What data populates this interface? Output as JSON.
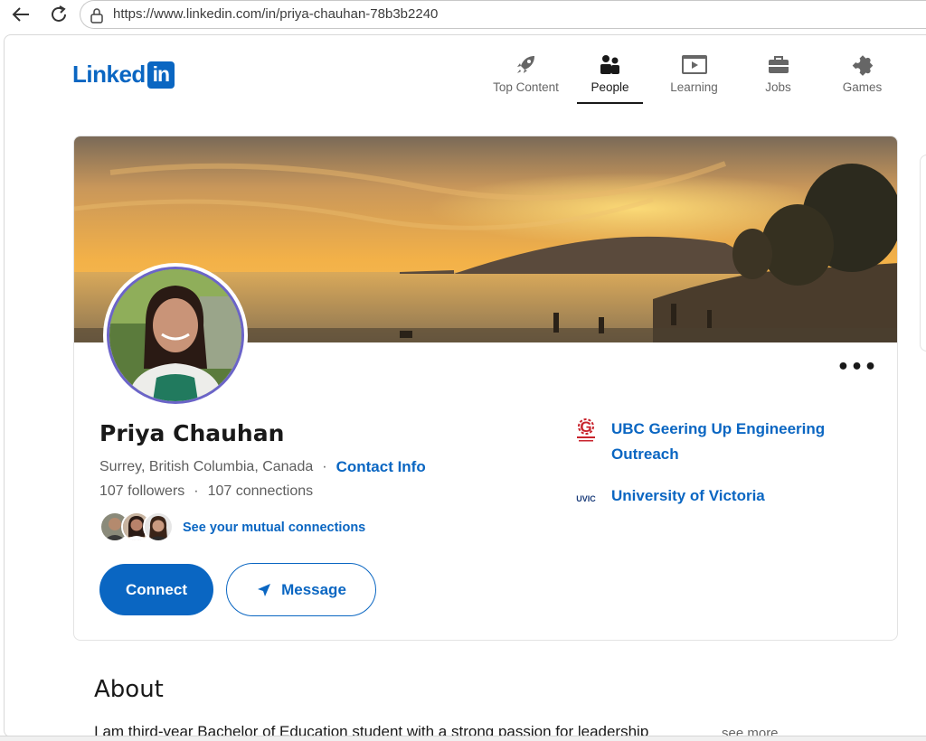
{
  "browser": {
    "url": "https://www.linkedin.com/in/priya-chauhan-78b3b2240"
  },
  "header": {
    "logo_text": "Linked",
    "logo_box": "in",
    "nav": [
      {
        "label": "Top Content",
        "icon": "rocket-icon"
      },
      {
        "label": "People",
        "icon": "people-icon"
      },
      {
        "label": "Learning",
        "icon": "video-icon"
      },
      {
        "label": "Jobs",
        "icon": "briefcase-icon"
      },
      {
        "label": "Games",
        "icon": "puzzle-icon"
      }
    ],
    "active_nav": "People"
  },
  "profile": {
    "name": "Priya Chauhan",
    "location": "Surrey, British Columbia, Canada",
    "separator": "·",
    "contact_label": "Contact Info",
    "followers": "107 followers",
    "connections": "107 connections",
    "mutual_label": "See your mutual connections",
    "more_label": "•••",
    "connect_label": "Connect",
    "message_label": "Message"
  },
  "organizations": [
    {
      "name": "UBC Geering Up Engineering Outreach",
      "logo_text": "UBC Geering Up Engineering Outreach"
    },
    {
      "name": "University of Victoria",
      "logo_text": "UVIC"
    }
  ],
  "about": {
    "title": "About",
    "text": "I am third-year Bachelor of Education student with a strong passion for leadership",
    "see_more": "see more"
  },
  "colors": {
    "brand": "#0a66c2",
    "avatar_ring": "#6b64c8"
  }
}
